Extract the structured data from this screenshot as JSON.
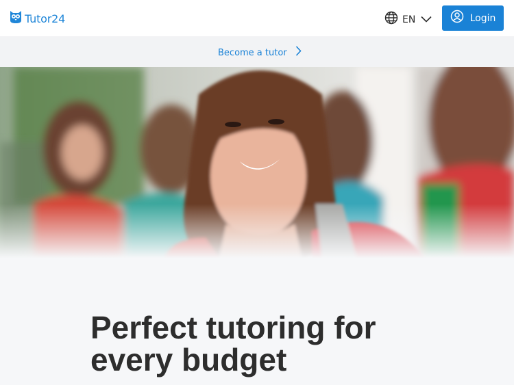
{
  "header": {
    "brand": "Tutor24",
    "language": "EN",
    "login_label": "Login"
  },
  "subbar": {
    "become_tutor_label": "Become a tutor"
  },
  "hero": {
    "image_description": "smiling-student-with-backpack"
  },
  "main": {
    "headline_line1": "Perfect tutoring for",
    "headline_line2": "every budget"
  },
  "colors": {
    "brand_blue": "#1a82d6",
    "header_bg": "#ffffff",
    "subbar_bg": "#f2f3f5",
    "page_bg": "#f6f7f9",
    "headline": "#2d2d2d"
  }
}
